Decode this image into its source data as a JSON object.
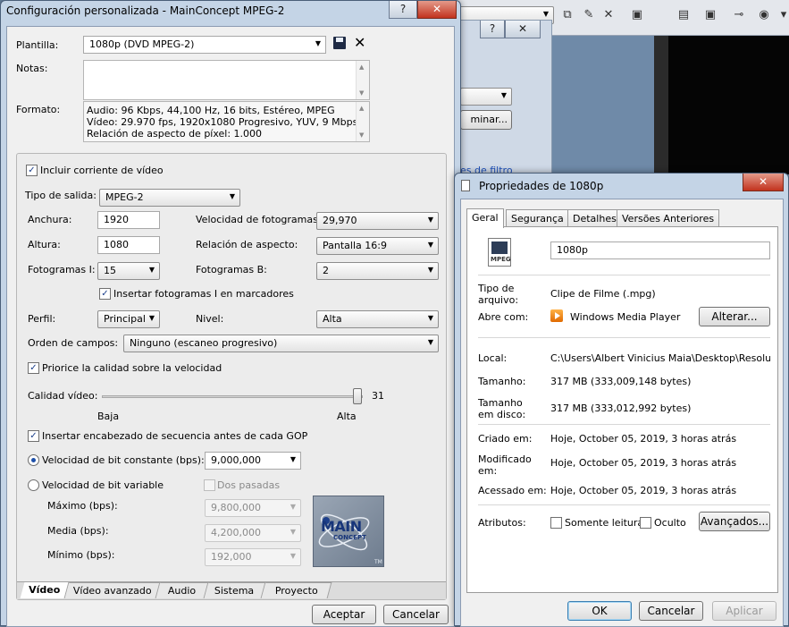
{
  "colors": {
    "accent": "#1d4fa8",
    "title_bar": "#c4d4e6",
    "close": "#c2331e"
  },
  "bg_app": {
    "filter_link": "es de filtro",
    "button_partial": "minar..."
  },
  "mc": {
    "title": "Configuración personalizada - MainConcept MPEG-2",
    "plantilla_label": "Plantilla:",
    "plantilla_value": "1080p (DVD MPEG-2)",
    "notas_label": "Notas:",
    "formato_label": "Formato:",
    "formato_lines": [
      "Audio: 96 Kbps, 44,100 Hz, 16 bits, Estéreo, MPEG",
      "Vídeo: 29.970 fps, 1920x1080 Progresivo, YUV, 9 Mbps",
      "Relación de aspecto de píxel: 1.000"
    ],
    "incluir_label": "Incluir corriente de vídeo",
    "tipo_salida_label": "Tipo de salida:",
    "tipo_salida_value": "MPEG-2",
    "anchura_label": "Anchura:",
    "anchura_value": "1920",
    "altura_label": "Altura:",
    "altura_value": "1080",
    "velocidad_label": "Velocidad de fotogramas:",
    "velocidad_value": "29,970",
    "relacion_label": "Relación de aspecto:",
    "relacion_value": "Pantalla 16:9",
    "fotogramas_i_label": "Fotogramas I:",
    "fotogramas_i_value": "15",
    "fotogramas_b_label": "Fotogramas B:",
    "fotogramas_b_value": "2",
    "insertar_i_label": "Insertar fotogramas I en marcadores",
    "perfil_label": "Perfil:",
    "perfil_value": "Principal",
    "nivel_label": "Nivel:",
    "nivel_value": "Alta",
    "orden_label": "Orden de campos:",
    "orden_value": "Ninguno (escaneo progresivo)",
    "priorice_label": "Priorice la calidad sobre la velocidad",
    "calidad_label": "Calidad vídeo:",
    "calidad_value": "31",
    "calidad_fraction": 0.98,
    "calidad_min_label": "Baja",
    "calidad_max_label": "Alta",
    "insertar_enc_label": "Insertar encabezado de secuencia antes de cada GOP",
    "bit_constante_label": "Velocidad de bit constante (bps):",
    "bit_constante_value": "9,000,000",
    "bit_variable_label": "Velocidad de bit variable",
    "dos_pasadas_label": "Dos pasadas",
    "maximo_label": "Máximo (bps):",
    "maximo_value": "9,800,000",
    "media_label": "Media (bps):",
    "media_value": "4,200,000",
    "minimo_label": "Mínimo (bps):",
    "minimo_value": "192,000",
    "tabs": [
      "Vídeo",
      "Vídeo avanzado",
      "Audio",
      "Sistema",
      "Proyecto"
    ],
    "aceptar": "Aceptar",
    "cancelar": "Cancelar"
  },
  "props": {
    "title": "Propriedades de 1080p",
    "tabs": [
      "Geral",
      "Segurança",
      "Detalhes",
      "Versões Anteriores"
    ],
    "icon_text": "MPEG",
    "filename": "1080p",
    "tipo_label": "Tipo de arquivo:",
    "tipo_value": "Clipe de Filme (.mpg)",
    "abre_label": "Abre com:",
    "abre_value": "Windows Media Player",
    "alterar": "Alterar...",
    "local_label": "Local:",
    "local_value": "C:\\Users\\Albert Vinicius Maia\\Desktop\\Resolution (",
    "tamanho_label": "Tamanho:",
    "tamanho_value": "317 MB (333,009,148 bytes)",
    "tamanho_disco_label": "Tamanho em disco:",
    "tamanho_disco_value": "317 MB (333,012,992 bytes)",
    "criado_label": "Criado em:",
    "criado_value": "Hoje, October 05, 2019, 3 horas atrás",
    "modificado_label": "Modificado em:",
    "modificado_value": "Hoje, October 05, 2019, 3 horas atrás",
    "acessado_label": "Acessado em:",
    "acessado_value": "Hoje, October 05, 2019, 3 horas atrás",
    "atributos_label": "Atributos:",
    "somente_label": "Somente leitura",
    "oculto_label": "Oculto",
    "avancados": "Avançados...",
    "ok": "OK",
    "cancelar": "Cancelar",
    "aplicar": "Aplicar"
  }
}
